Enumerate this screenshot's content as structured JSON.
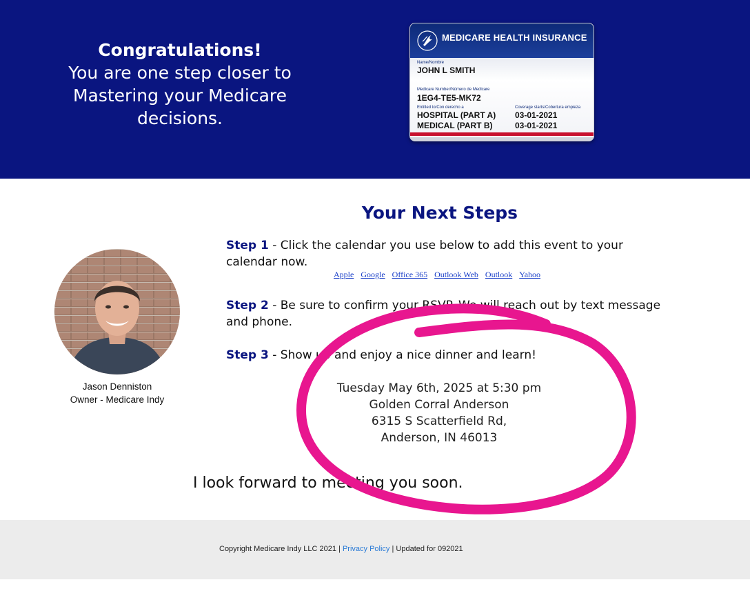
{
  "hero": {
    "headline": "Congratulations!",
    "subtext_lines": [
      "You are one step closer to",
      "Mastering your Medicare",
      "decisions."
    ],
    "background_color": "#0a1580"
  },
  "medicare_card": {
    "title": "MEDICARE HEALTH INSURANCE",
    "name_label": "Name/Nombre",
    "name": "JOHN L SMITH",
    "number_label": "Medicare Number/Número de Medicare",
    "number": "1EG4-TE5-MK72",
    "entitled_label": "Entitled to/Con derecho a",
    "coverage_label": "Coverage starts/Cobertura empieza",
    "part_a": "HOSPITAL  (PART A)",
    "part_a_date": "03-01-2021",
    "part_b": "MEDICAL  (PART B)",
    "part_b_date": "03-01-2021",
    "logo_icon": "hhs-eagle-icon"
  },
  "steps": {
    "title": "Your Next Steps",
    "step1_label": "Step 1",
    "step1_text": " - Click the calendar you use below to add this event to your calendar now.",
    "calendar_links": [
      "Apple",
      "Google",
      "Office 365",
      "Outlook Web",
      "Outlook",
      "Yahoo"
    ],
    "step2_label": "Step 2",
    "step2_text": " - Be sure to confirm your RSVP. We will reach out by text message and phone.",
    "step3_label": "Step 3",
    "step3_text": " - Show up and enjoy a nice dinner and learn!"
  },
  "event": {
    "datetime": "Tuesday May 6th, 2025 at 5:30 pm",
    "venue": "Golden Corral Anderson",
    "street": "6315 S Scatterfield Rd,",
    "city": "Anderson, IN 46013"
  },
  "profile": {
    "name": "Jason Denniston",
    "title": "Owner - Medicare Indy"
  },
  "closing": "I look forward to meeting you soon.",
  "footer": {
    "copyright": "Copyright Medicare Indy LLC 2021 | ",
    "privacy_link": "Privacy Policy",
    "updated": " | Updated for 092021"
  },
  "colors": {
    "brand_navy": "#0a1580",
    "highlight_circle": "#e8168f",
    "link_blue": "#1a3fc8"
  }
}
